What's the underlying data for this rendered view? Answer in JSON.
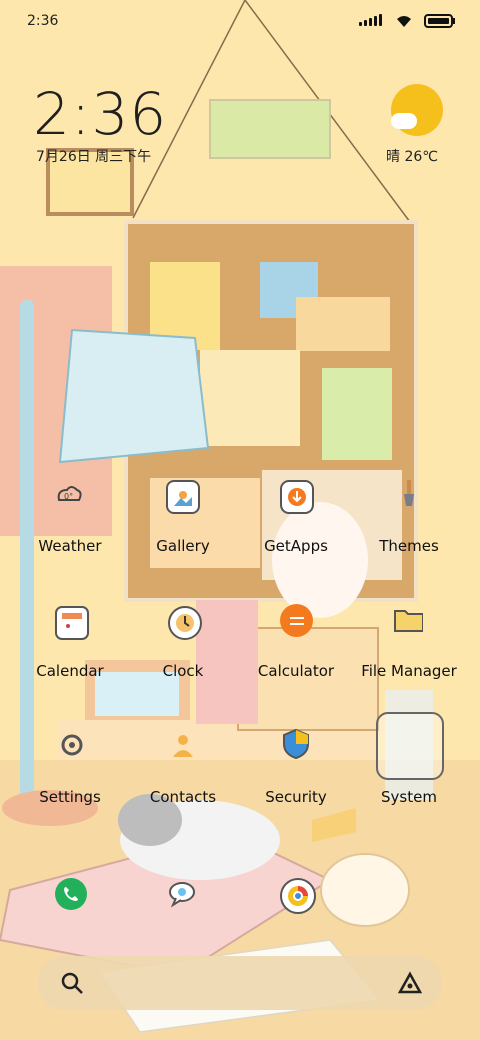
{
  "status_bar": {
    "time": "2:36"
  },
  "widget": {
    "clock": "2:36",
    "date": "7月26日 周三下午",
    "weather": "晴 26℃"
  },
  "apps": [
    {
      "label": "Weather"
    },
    {
      "label": "Gallery"
    },
    {
      "label": "GetApps"
    },
    {
      "label": "Themes"
    },
    {
      "label": "Calendar"
    },
    {
      "label": "Clock"
    },
    {
      "label": "Calculator"
    },
    {
      "label": "File Manager"
    },
    {
      "label": "Settings"
    },
    {
      "label": "Contacts"
    },
    {
      "label": "Security"
    },
    {
      "label": "System"
    }
  ],
  "dock": {
    "apps": [
      "phone-icon",
      "messages-icon",
      "browser-icon"
    ]
  },
  "search_bar": {
    "left_icon": "search-icon",
    "right_icon": "assistant-icon"
  },
  "colors": {
    "wall": "#fde7ad",
    "floor": "#f6d9a3",
    "accent": "#f6c01c",
    "calculator": "#f47a20",
    "phone": "#22b05a"
  }
}
